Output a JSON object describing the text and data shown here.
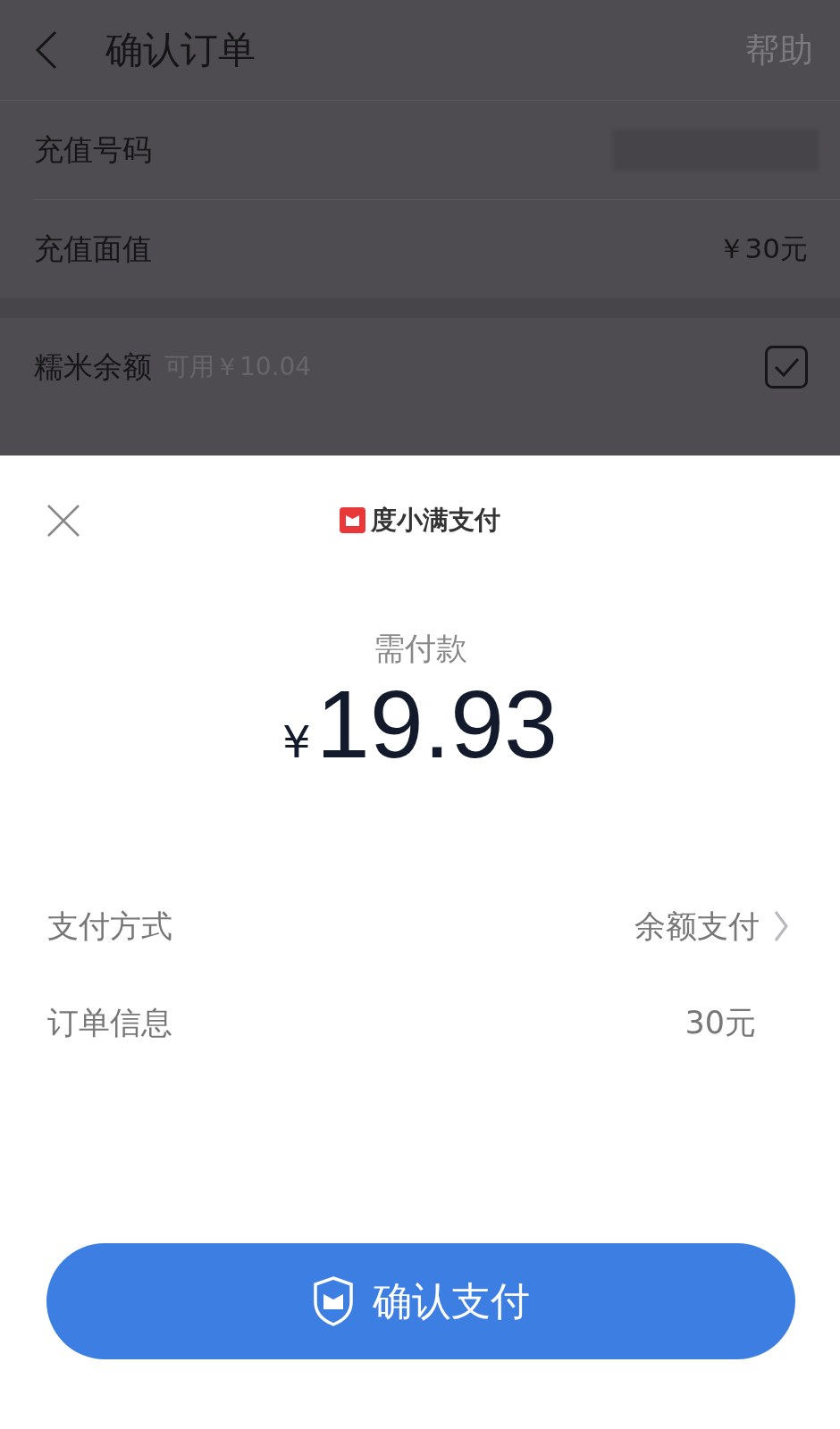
{
  "header": {
    "title": "确认订单",
    "action": "帮助"
  },
  "order_rows": [
    {
      "kind": "masked",
      "label": "充值号码"
    },
    {
      "kind": "value",
      "label": "充值面值",
      "value": "￥30元"
    }
  ],
  "balance_row": {
    "label": "糯米余额",
    "note": "可用￥10.04",
    "checked": true
  },
  "sheet": {
    "brand": "度小满支付",
    "amount_label": "需付款",
    "currency": "¥",
    "amount": "19.93",
    "details": [
      {
        "kind": "link",
        "label": "支付方式",
        "value": "余额支付"
      },
      {
        "kind": "plain",
        "label": "订单信息",
        "value": "30元"
      }
    ],
    "button": "确认支付"
  }
}
